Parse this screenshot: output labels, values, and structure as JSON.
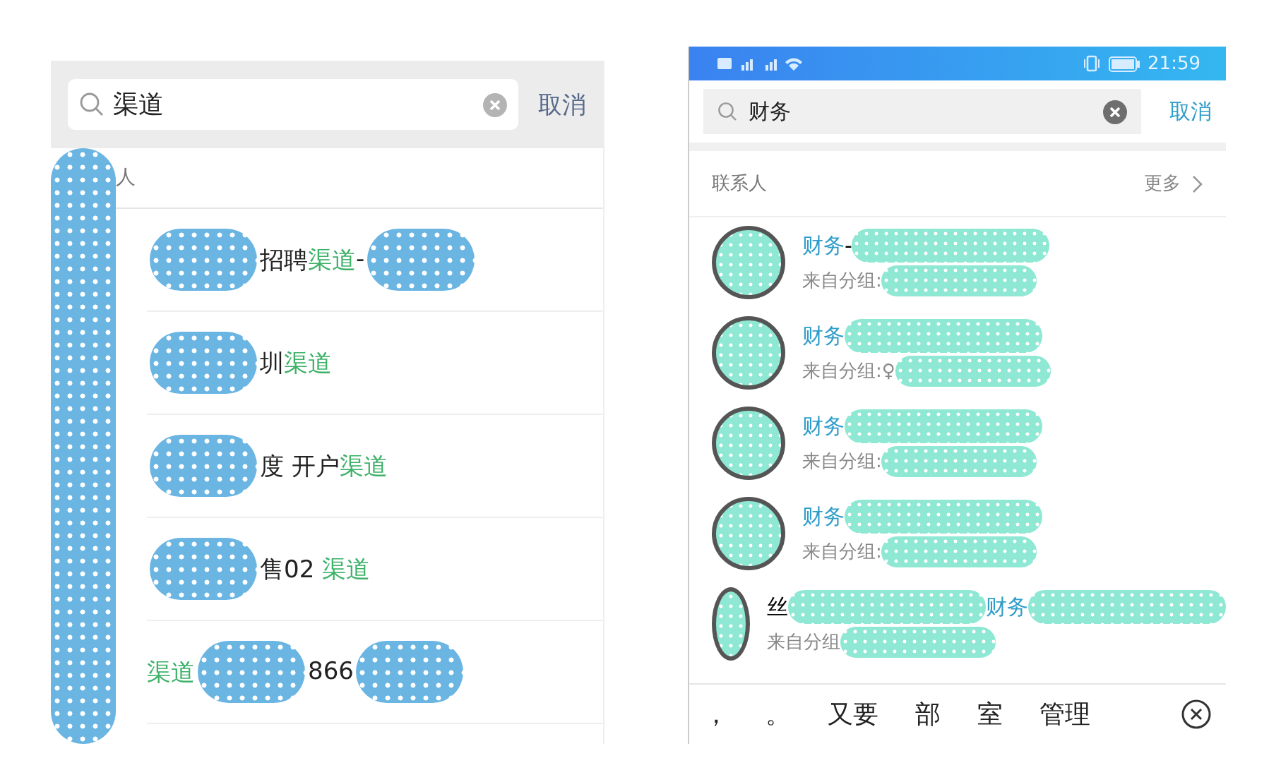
{
  "left_panel": {
    "search": {
      "value": "渠道",
      "cancel": "取消"
    },
    "section_header": "人",
    "results": [
      {
        "segments": [
          {
            "kind": "redacted"
          },
          {
            "kind": "plain",
            "text": "招聘"
          },
          {
            "kind": "match",
            "text": "渠道"
          },
          {
            "kind": "plain",
            "text": "-"
          },
          {
            "kind": "redacted"
          }
        ]
      },
      {
        "segments": [
          {
            "kind": "redacted"
          },
          {
            "kind": "plain",
            "text": "圳"
          },
          {
            "kind": "match",
            "text": "渠道"
          }
        ]
      },
      {
        "segments": [
          {
            "kind": "redacted"
          },
          {
            "kind": "plain",
            "text": "度 开户"
          },
          {
            "kind": "match",
            "text": "渠道"
          }
        ]
      },
      {
        "segments": [
          {
            "kind": "redacted"
          },
          {
            "kind": "plain",
            "text": "售02 "
          },
          {
            "kind": "match",
            "text": "渠道"
          }
        ]
      },
      {
        "segments": [
          {
            "kind": "match",
            "text": "渠道"
          },
          {
            "kind": "redacted"
          },
          {
            "kind": "plain",
            "text": "866"
          },
          {
            "kind": "redacted"
          }
        ]
      }
    ]
  },
  "right_panel": {
    "status_bar": {
      "time": "21:59"
    },
    "search": {
      "value": "财务",
      "cancel": "取消"
    },
    "section_header": {
      "title": "联系人",
      "more": "更多"
    },
    "results": [
      {
        "name": [
          {
            "kind": "match",
            "text": "财务"
          },
          {
            "kind": "plain",
            "text": "-"
          },
          {
            "kind": "redacted"
          }
        ],
        "group": [
          {
            "kind": "plain",
            "text": "来自分组:"
          },
          {
            "kind": "redacted"
          }
        ]
      },
      {
        "name": [
          {
            "kind": "match",
            "text": "财务"
          },
          {
            "kind": "redacted"
          }
        ],
        "group": [
          {
            "kind": "plain",
            "text": "来自分组:♀"
          },
          {
            "kind": "redacted"
          }
        ]
      },
      {
        "name": [
          {
            "kind": "match",
            "text": "财务"
          },
          {
            "kind": "redacted"
          }
        ],
        "group": [
          {
            "kind": "plain",
            "text": "来自分组:"
          },
          {
            "kind": "redacted"
          }
        ]
      },
      {
        "name": [
          {
            "kind": "match",
            "text": "财务"
          },
          {
            "kind": "redacted"
          }
        ],
        "group": [
          {
            "kind": "plain",
            "text": "来自分组:"
          },
          {
            "kind": "redacted"
          }
        ]
      },
      {
        "name": [
          {
            "kind": "plain",
            "text": "丝"
          },
          {
            "kind": "redacted"
          },
          {
            "kind": "match",
            "text": "财务"
          },
          {
            "kind": "redacted"
          }
        ],
        "group": [
          {
            "kind": "plain",
            "text": "来自分组"
          },
          {
            "kind": "redacted"
          }
        ]
      }
    ],
    "candidates": [
      "，",
      "。",
      "又要",
      "部",
      "室",
      "管理"
    ]
  }
}
